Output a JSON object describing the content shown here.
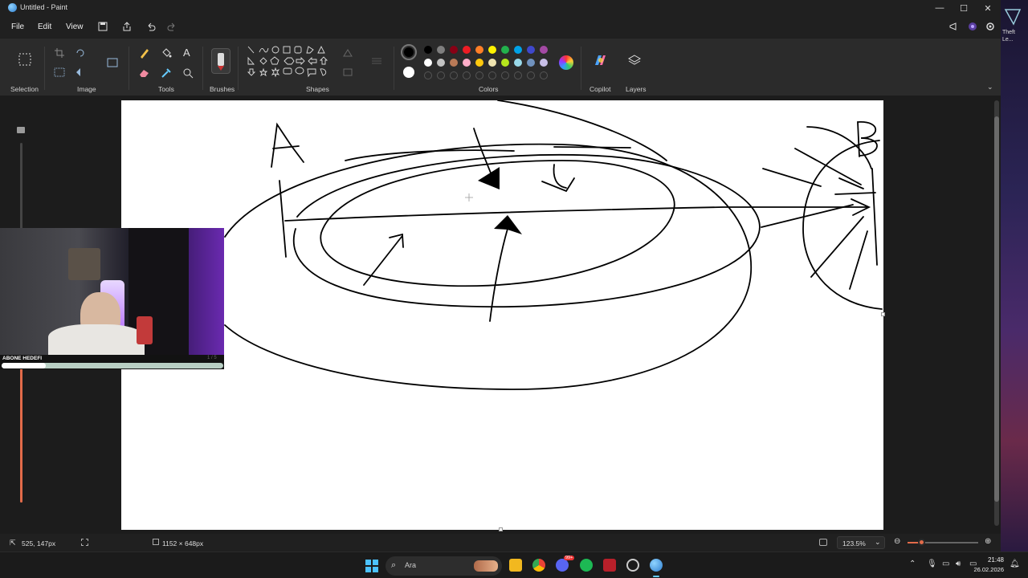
{
  "window": {
    "title": "Untitled - Paint",
    "controls": {
      "minimize": "—",
      "maximize": "☐",
      "close": "✕"
    }
  },
  "menu": {
    "file": "File",
    "edit": "Edit",
    "view": "View"
  },
  "ribbon": {
    "groups": {
      "selection": "Selection",
      "image": "Image",
      "tools": "Tools",
      "brushes": "Brushes",
      "shapes": "Shapes",
      "colors": "Colors",
      "copilot": "Copilot",
      "layers": "Layers"
    },
    "palette_row1": [
      "#000000",
      "#7f7f7f",
      "#880015",
      "#ed1c24",
      "#ff7f27",
      "#fff200",
      "#22b14c",
      "#00a2e8",
      "#3f48cc",
      "#a349a4"
    ],
    "palette_row2": [
      "#ffffff",
      "#c3c3c3",
      "#b97a57",
      "#ffaec9",
      "#ffc90e",
      "#efe4b0",
      "#b5e61d",
      "#99d9ea",
      "#7092be",
      "#c8bfe7"
    ],
    "primary_color": "#000000",
    "secondary_color": "#ffffff"
  },
  "canvas": {
    "labels": {
      "a": "A",
      "b": "B"
    },
    "background": "#ffffff"
  },
  "webcam": {
    "subscribe_label": "ABONE HEDEFI",
    "subscribe_count": "1 / 5"
  },
  "status": {
    "cursor_pos": "525, 147px",
    "canvas_size": "1152 × 648px",
    "zoom": "123.5%"
  },
  "taskbar": {
    "search_placeholder": "Ara",
    "time": "21:48",
    "date": "26.02.2026",
    "notification_badge": "99+"
  },
  "desktop": {
    "partial_text": "Theft\nLe..."
  }
}
